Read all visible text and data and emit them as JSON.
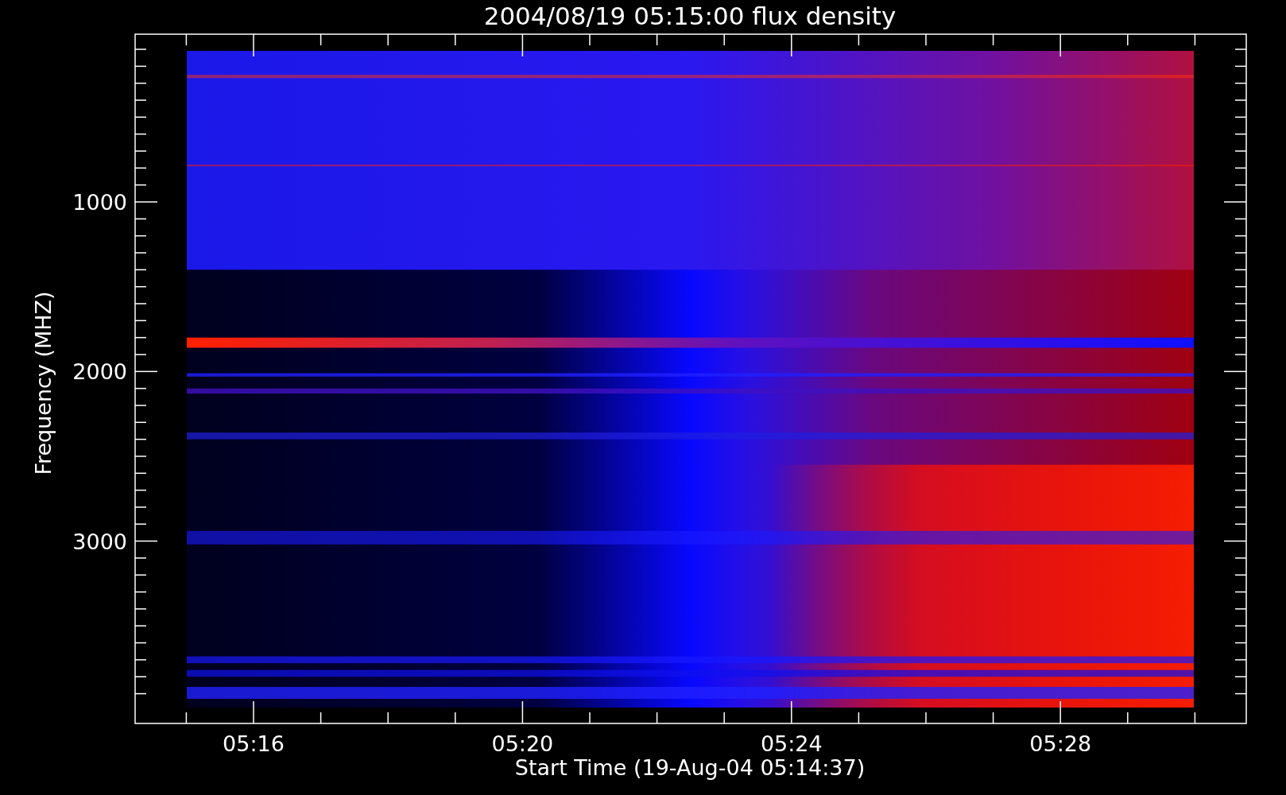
{
  "plot": {
    "title": "2004/08/19 05:15:00 flux density",
    "y_axis": {
      "label": "Frequency (MHZ)",
      "tick_labels": [
        "1000",
        "2000",
        "3000"
      ]
    },
    "x_axis": {
      "label": "Start Time (19-Aug-04 05:14:37)",
      "tick_labels": [
        "05:16",
        "05:20",
        "05:24",
        "05:28"
      ]
    }
  }
}
